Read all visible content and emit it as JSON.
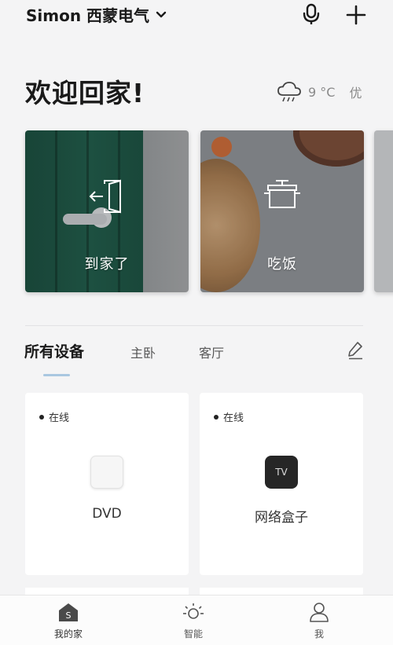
{
  "header": {
    "home_name": "Simon 西蒙电气",
    "icons": [
      "chevron-down-icon",
      "microphone-icon",
      "plus-icon"
    ]
  },
  "welcome": {
    "greeting": "欢迎回家!",
    "weather_icon": "cloud-rain-icon",
    "temperature": "9 °C",
    "air_quality": "优"
  },
  "scenes": [
    {
      "label": "到家了",
      "icon": "door-enter-icon"
    },
    {
      "label": "吃饭",
      "icon": "cooking-pot-icon"
    }
  ],
  "rooms": {
    "tabs": [
      {
        "label": "所有设备",
        "active": true
      },
      {
        "label": "主卧",
        "active": false
      },
      {
        "label": "客厅",
        "active": false
      }
    ],
    "edit_icon": "pencil-icon"
  },
  "devices": [
    {
      "status": "在线",
      "name": "DVD",
      "icon": "dvd-player-icon"
    },
    {
      "status": "在线",
      "name": "网络盒子",
      "icon_text": "TV",
      "icon": "tv-box-icon"
    }
  ],
  "tabbar": [
    {
      "label": "我的家",
      "icon": "home-s-icon",
      "icon_text": "S",
      "active": true
    },
    {
      "label": "智能",
      "icon": "sun-icon",
      "active": false
    },
    {
      "label": "我",
      "icon": "person-icon",
      "active": false
    }
  ],
  "colors": {
    "background": "#f4f4f5",
    "tab_underline": "#a9c7e0",
    "text_dark": "#1a1a1a"
  }
}
